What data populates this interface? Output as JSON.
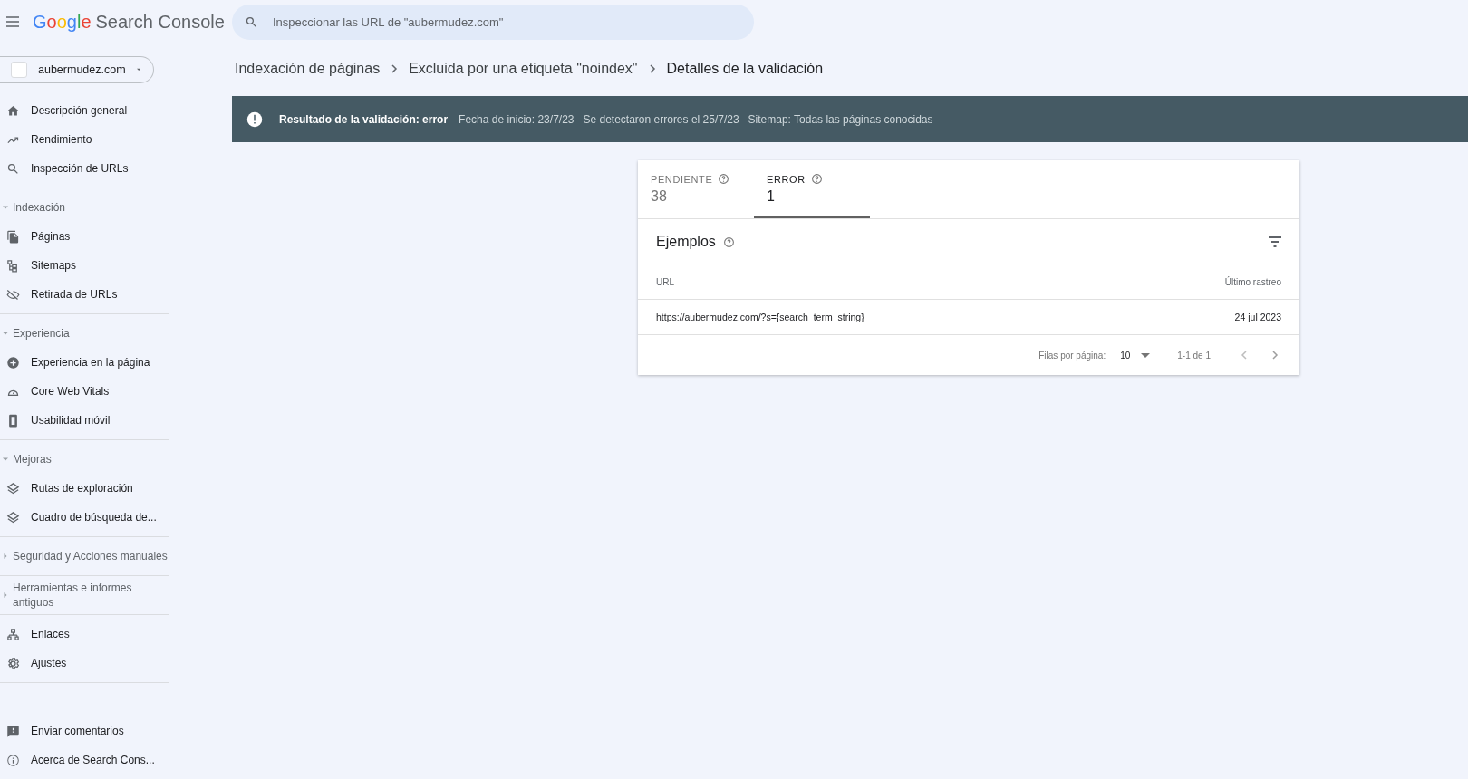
{
  "header": {
    "brand": "Google",
    "product": "Search Console",
    "search": {
      "placeholder": "Inspeccionar las URL de \"aubermudez.com\""
    }
  },
  "property": {
    "label": "aubermudez.com"
  },
  "sidebar": {
    "sections": [
      {
        "items": [
          {
            "label": "Descripción general"
          },
          {
            "label": "Rendimiento"
          },
          {
            "label": "Inspección de URLs"
          }
        ]
      },
      {
        "header": {
          "label": "Indexación",
          "expanded": true
        },
        "items": [
          {
            "label": "Páginas"
          },
          {
            "label": "Sitemaps"
          },
          {
            "label": "Retirada de URLs"
          }
        ]
      },
      {
        "header": {
          "label": "Experiencia",
          "expanded": true
        },
        "items": [
          {
            "label": "Experiencia en la página"
          },
          {
            "label": "Core Web Vitals"
          },
          {
            "label": "Usabilidad móvil"
          }
        ]
      },
      {
        "header": {
          "label": "Mejoras",
          "expanded": true
        },
        "items": [
          {
            "label": "Rutas de exploración"
          },
          {
            "label": "Cuadro de búsqueda de..."
          }
        ]
      },
      {
        "header": {
          "label": "Seguridad y Acciones manuales",
          "expanded": false
        }
      },
      {
        "header": {
          "label": "Herramientas e informes antiguos",
          "expanded": false
        }
      },
      {
        "items": [
          {
            "label": "Enlaces"
          },
          {
            "label": "Ajustes"
          }
        ]
      }
    ],
    "footer": [
      {
        "label": "Enviar comentarios"
      },
      {
        "label": "Acerca de Search Cons..."
      }
    ]
  },
  "breadcrumb": [
    "Indexación de páginas",
    "Excluida por una etiqueta \"noindex\"",
    "Detalles de la validación"
  ],
  "banner": {
    "result": "Resultado de la validación: error",
    "details": [
      "Fecha de inicio: 23/7/23",
      "Se detectaron errores el 25/7/23",
      "Sitemap: Todas las páginas conocidas"
    ]
  },
  "card": {
    "tabs": [
      {
        "label": "PENDIENTE",
        "count": "38",
        "selected": false
      },
      {
        "label": "ERROR",
        "count": "1",
        "selected": true
      }
    ],
    "title": "Ejemplos",
    "columns": [
      "URL",
      "Último rastreo"
    ],
    "rows": [
      [
        "https://aubermudez.com/?s={search_term_string}",
        "24 jul 2023"
      ]
    ],
    "pagination": {
      "rows_label": "Filas por página:",
      "rows_value": "10",
      "range": "1-1 de 1"
    }
  }
}
